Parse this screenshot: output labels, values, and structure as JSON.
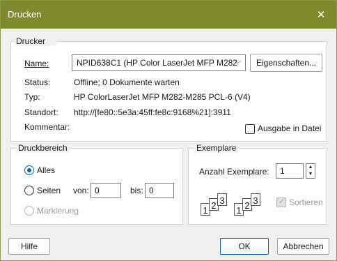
{
  "window": {
    "title": "Drucken",
    "close_glyph": "✕"
  },
  "printer": {
    "group_label": "Drucker",
    "name_label": "Name:",
    "name_value": "NPID638C1 (HP Color LaserJet MFP M282",
    "properties_button": "Eigenschaften...",
    "status_label": "Status:",
    "status_value": "Offline; 0 Dokumente warten",
    "type_label": "Typ:",
    "type_value": "HP ColorLaserJet MFP M282-M285 PCL-6 (V4)",
    "location_label": "Standort:",
    "location_value": "http://[fe80::5e3a:45ff:fe8c:9168%21]:3911",
    "comment_label": "Kommentar:",
    "print_to_file_label": "Ausgabe in Datei"
  },
  "range": {
    "group_label": "Druckbereich",
    "all_label": "Alles",
    "pages_label": "Seiten",
    "from_label": "von:",
    "from_value": "0",
    "to_label": "bis:",
    "to_value": "0",
    "selection_label": "Markierung"
  },
  "copies": {
    "group_label": "Exemplare",
    "count_label": "Anzahl Exemplare:",
    "count_value": "1",
    "collate_label": "Sortieren",
    "page_numbers": [
      "1",
      "2",
      "3"
    ]
  },
  "footer": {
    "help_button": "Hilfe",
    "ok_button": "OK",
    "cancel_button": "Abbrechen"
  },
  "colors": {
    "titlebar": "#7f8a2c",
    "accent": "#0067c0"
  },
  "icons": [
    "close-icon",
    "chevron-down-icon",
    "spin-up-icon",
    "spin-down-icon",
    "collate-pages-icon"
  ]
}
